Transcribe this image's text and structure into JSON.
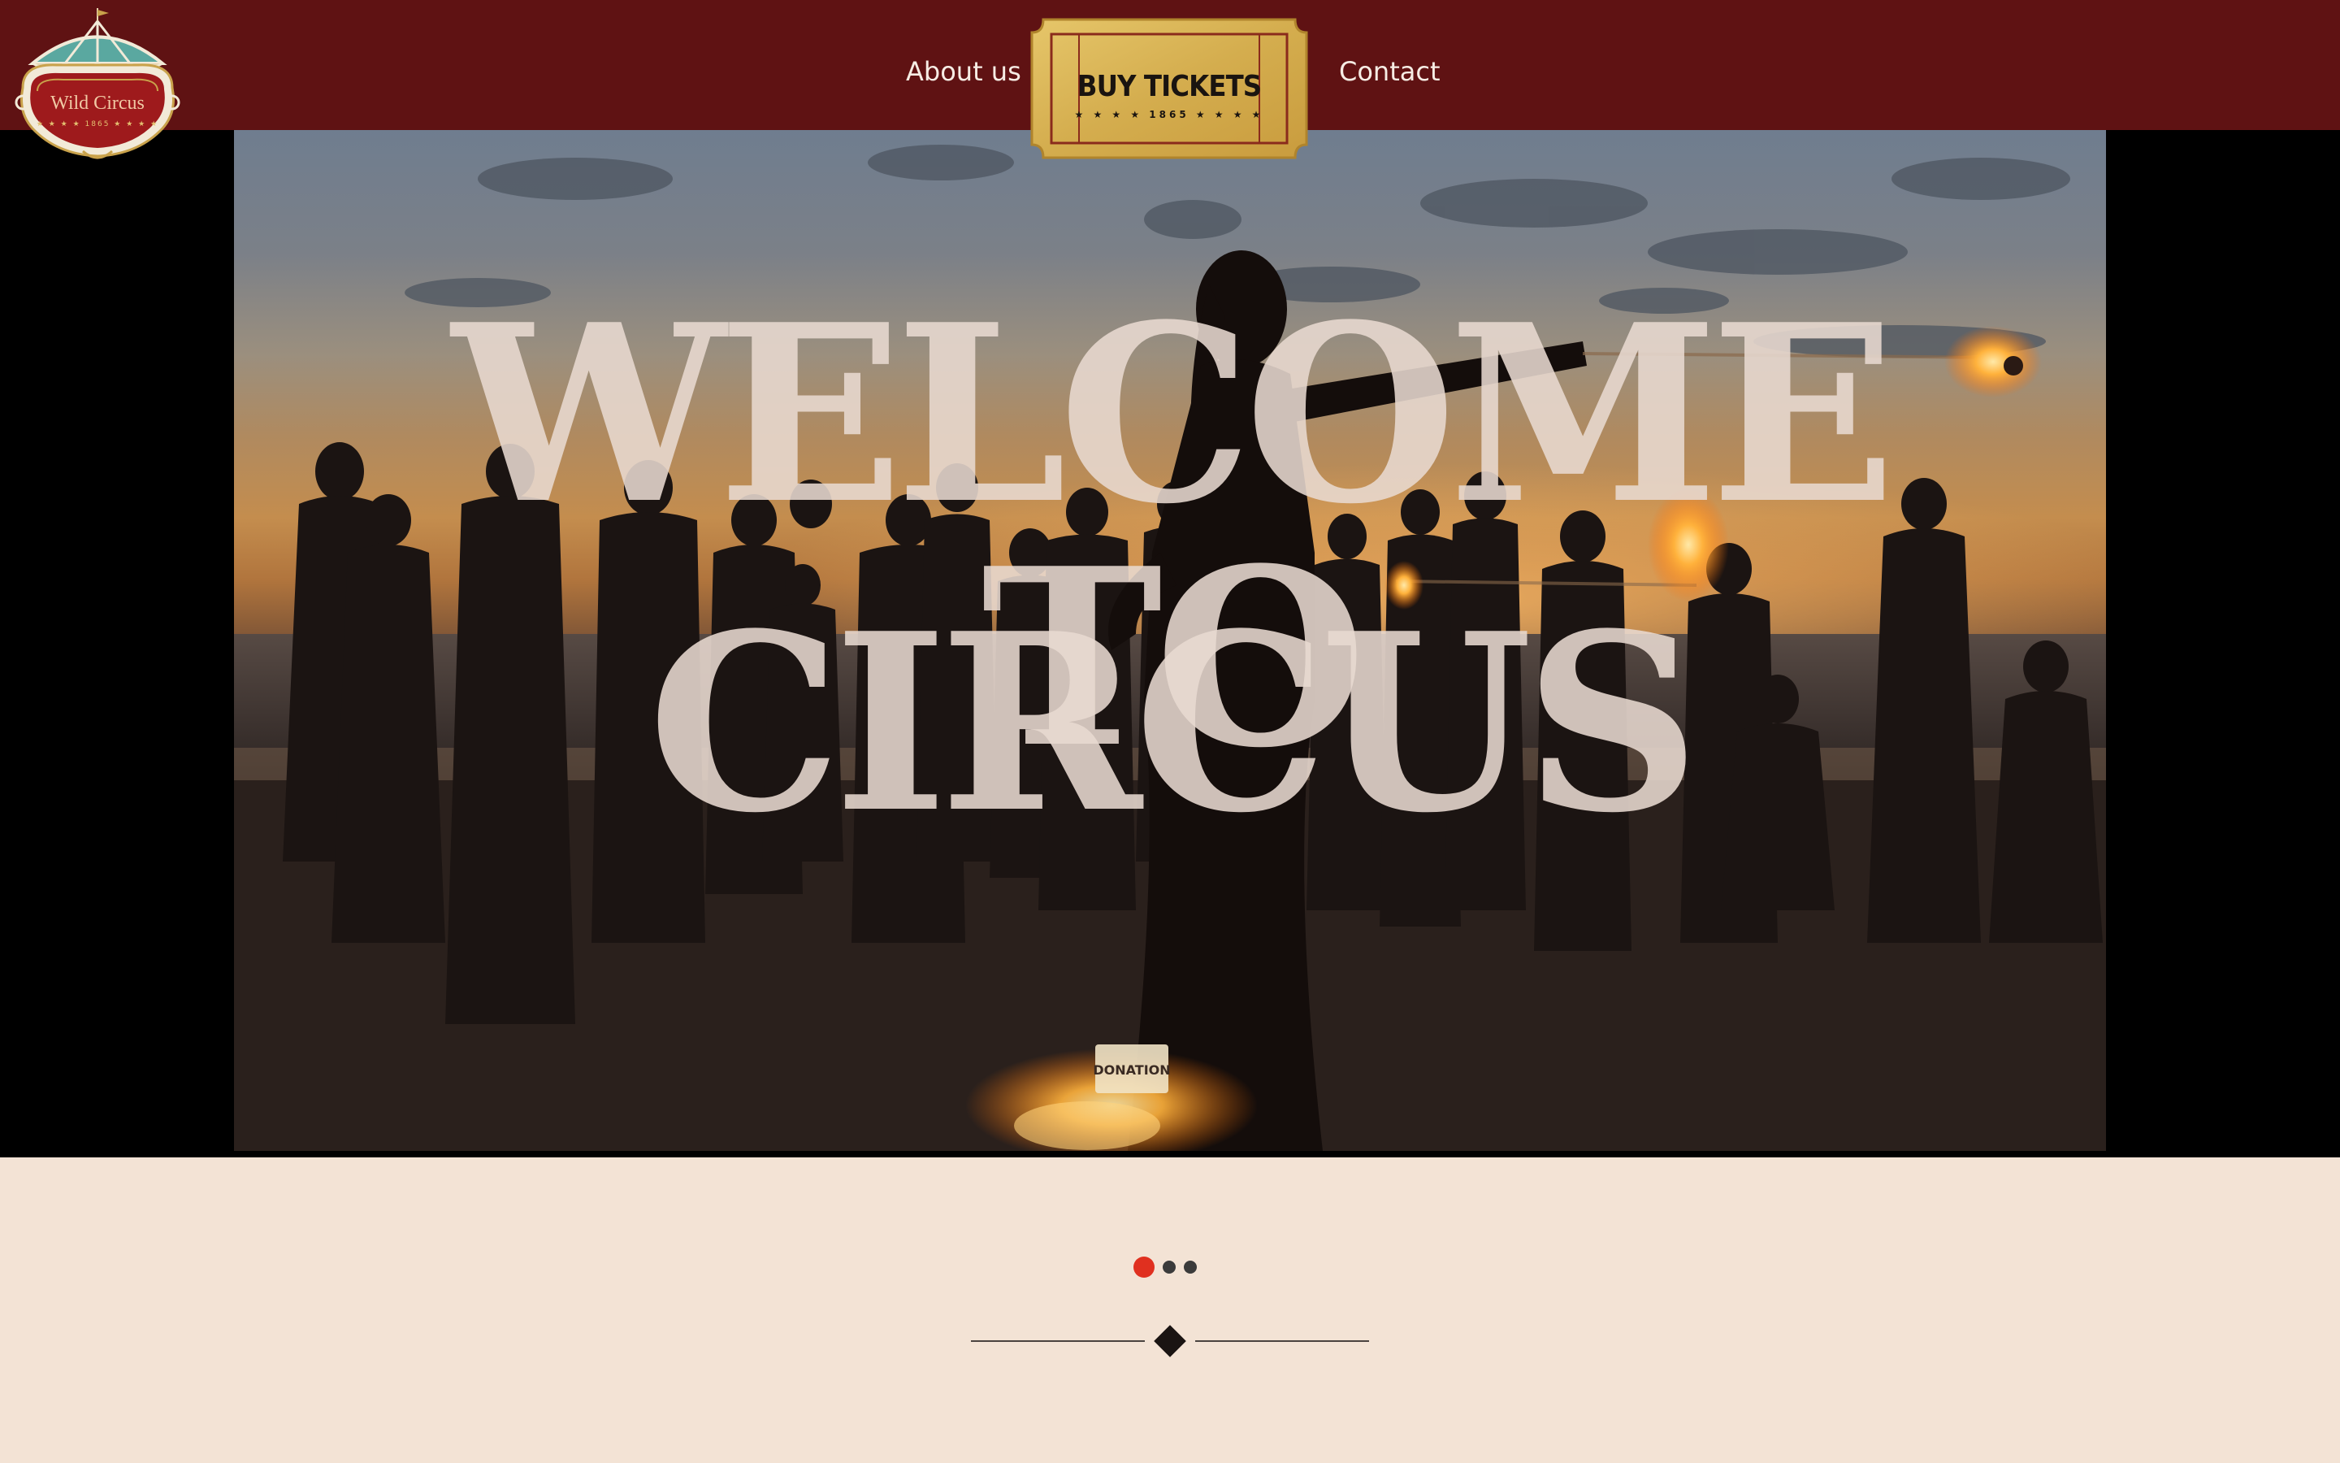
{
  "header": {
    "logo": {
      "name": "Wild Circus",
      "year_badge": "★ ★ ★ ★  1865  ★ ★ ★ ★"
    },
    "nav": {
      "about_label": "About us",
      "contact_label": "Contact"
    },
    "ticket": {
      "title": "BUY TICKETS",
      "sub": "★ ★ ★ ★   1865   ★ ★ ★ ★"
    },
    "colors": {
      "bar": "#5f1213",
      "ticket_gold": "#d9b556"
    }
  },
  "hero": {
    "headline_line1": "WELCOME TO",
    "headline_line2": "CIRCUS",
    "sign_text": "DONATION"
  },
  "carousel": {
    "slides": 3,
    "active_index": 0,
    "active_color": "#e0301f"
  },
  "page": {
    "background": "#f3e3d5"
  }
}
